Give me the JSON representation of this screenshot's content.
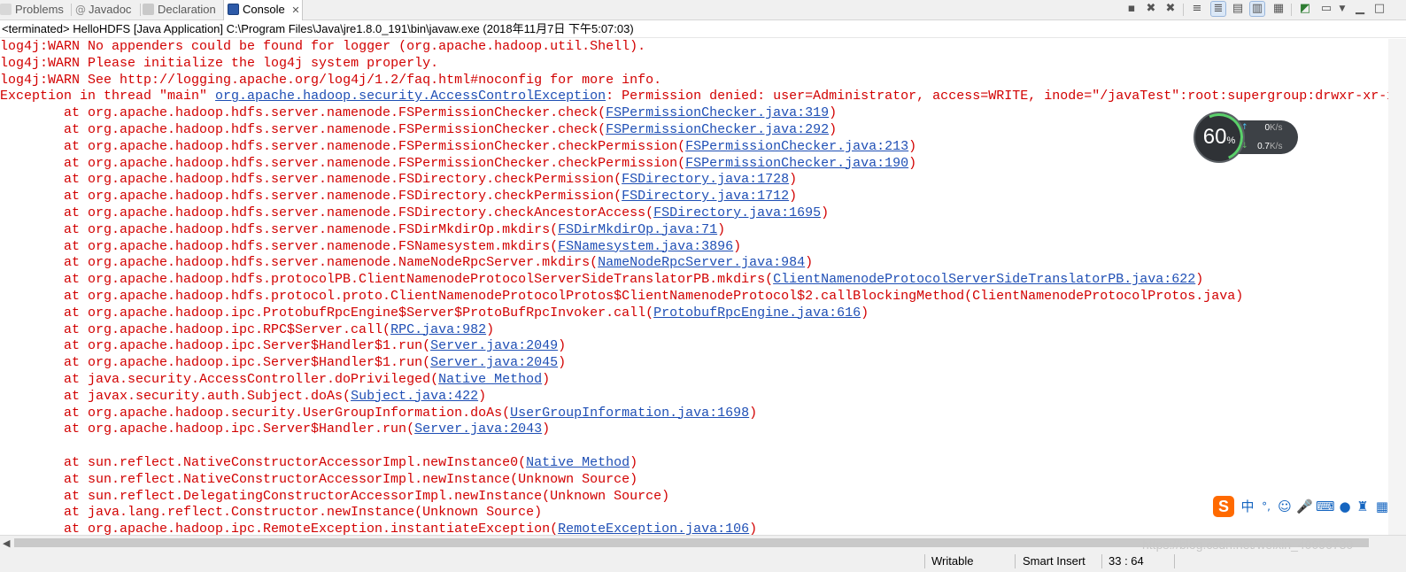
{
  "tabs": [
    {
      "label": "Problems",
      "icon": "problems-icon"
    },
    {
      "label": "Javadoc",
      "icon": "javadoc-icon"
    },
    {
      "label": "Declaration",
      "icon": "declaration-icon"
    },
    {
      "label": "Console",
      "icon": "console-icon",
      "active": true,
      "close": "✕"
    }
  ],
  "toolbar_icons": [
    "clear-console-icon",
    "terminate-icon",
    "remove-all-terminated-icon",
    "scroll-lock-icon",
    "word-wrap-icon",
    "show-on-stdout-icon",
    "show-on-stderr-icon",
    "pin-console-icon",
    "display-console-icon",
    "dropdown-icon",
    "open-console-icon",
    "minimize-icon",
    "maximize-icon"
  ],
  "process_line": "<terminated> HelloHDFS [Java Application] C:\\Program Files\\Java\\jre1.8.0_191\\bin\\javaw.exe (2018年11月7日 下午5:07:03)",
  "console": {
    "warn1": "log4j:WARN No appenders could be found for logger (org.apache.hadoop.util.Shell).",
    "warn2": "log4j:WARN Please initialize the log4j system properly.",
    "warn3": "log4j:WARN See http://logging.apache.org/log4j/1.2/faq.html#noconfig for more info.",
    "exception_prefix": "Exception in thread \"main\" ",
    "exception_class": "org.apache.hadoop.security.AccessControlException",
    "exception_message": ": Permission denied: user=Administrator, access=WRITE, inode=\"/javaTest\":root:supergroup:drwxr-xr-x",
    "frames": [
      {
        "at": "at org.apache.hadoop.hdfs.server.namenode.FSPermissionChecker.check(",
        "link": "FSPermissionChecker.java:319",
        "end": ")"
      },
      {
        "at": "at org.apache.hadoop.hdfs.server.namenode.FSPermissionChecker.check(",
        "link": "FSPermissionChecker.java:292",
        "end": ")"
      },
      {
        "at": "at org.apache.hadoop.hdfs.server.namenode.FSPermissionChecker.checkPermission(",
        "link": "FSPermissionChecker.java:213",
        "end": ")"
      },
      {
        "at": "at org.apache.hadoop.hdfs.server.namenode.FSPermissionChecker.checkPermission(",
        "link": "FSPermissionChecker.java:190",
        "end": ")"
      },
      {
        "at": "at org.apache.hadoop.hdfs.server.namenode.FSDirectory.checkPermission(",
        "link": "FSDirectory.java:1728",
        "end": ")"
      },
      {
        "at": "at org.apache.hadoop.hdfs.server.namenode.FSDirectory.checkPermission(",
        "link": "FSDirectory.java:1712",
        "end": ")"
      },
      {
        "at": "at org.apache.hadoop.hdfs.server.namenode.FSDirectory.checkAncestorAccess(",
        "link": "FSDirectory.java:1695",
        "end": ")"
      },
      {
        "at": "at org.apache.hadoop.hdfs.server.namenode.FSDirMkdirOp.mkdirs(",
        "link": "FSDirMkdirOp.java:71",
        "end": ")"
      },
      {
        "at": "at org.apache.hadoop.hdfs.server.namenode.FSNamesystem.mkdirs(",
        "link": "FSNamesystem.java:3896",
        "end": ")"
      },
      {
        "at": "at org.apache.hadoop.hdfs.server.namenode.NameNodeRpcServer.mkdirs(",
        "link": "NameNodeRpcServer.java:984",
        "end": ")"
      },
      {
        "at": "at org.apache.hadoop.hdfs.protocolPB.ClientNamenodeProtocolServerSideTranslatorPB.mkdirs(",
        "link": "ClientNamenodeProtocolServerSideTranslatorPB.java:622",
        "end": ")"
      },
      {
        "at": "at org.apache.hadoop.hdfs.protocol.proto.ClientNamenodeProtocolProtos$ClientNamenodeProtocol$2.callBlockingMethod(ClientNamenodeProtocolProtos.java)",
        "link": "",
        "end": ""
      },
      {
        "at": "at org.apache.hadoop.ipc.ProtobufRpcEngine$Server$ProtoBufRpcInvoker.call(",
        "link": "ProtobufRpcEngine.java:616",
        "end": ")"
      },
      {
        "at": "at org.apache.hadoop.ipc.RPC$Server.call(",
        "link": "RPC.java:982",
        "end": ")"
      },
      {
        "at": "at org.apache.hadoop.ipc.Server$Handler$1.run(",
        "link": "Server.java:2049",
        "end": ")"
      },
      {
        "at": "at org.apache.hadoop.ipc.Server$Handler$1.run(",
        "link": "Server.java:2045",
        "end": ")"
      },
      {
        "at": "at java.security.AccessController.doPrivileged(",
        "link": "Native Method",
        "end": ")"
      },
      {
        "at": "at javax.security.auth.Subject.doAs(",
        "link": "Subject.java:422",
        "end": ")"
      },
      {
        "at": "at org.apache.hadoop.security.UserGroupInformation.doAs(",
        "link": "UserGroupInformation.java:1698",
        "end": ")"
      },
      {
        "at": "at org.apache.hadoop.ipc.Server$Handler.run(",
        "link": "Server.java:2043",
        "end": ")"
      },
      {
        "at": "",
        "link": "",
        "end": ""
      },
      {
        "at": "at sun.reflect.NativeConstructorAccessorImpl.newInstance0(",
        "link": "Native Method",
        "end": ")"
      },
      {
        "at": "at sun.reflect.NativeConstructorAccessorImpl.newInstance(Unknown Source)",
        "link": "",
        "end": ""
      },
      {
        "at": "at sun.reflect.DelegatingConstructorAccessorImpl.newInstance(Unknown Source)",
        "link": "",
        "end": ""
      },
      {
        "at": "at java.lang.reflect.Constructor.newInstance(Unknown Source)",
        "link": "",
        "end": ""
      },
      {
        "at": "at org.apache.hadoop.ipc.RemoteException.instantiateException(",
        "link": "RemoteException.java:106",
        "end": ")"
      }
    ]
  },
  "net_widget": {
    "percent": "60",
    "percent_unit": "%",
    "up_rate": "0",
    "down_rate": "0.7",
    "rate_unit": "K/s",
    "ring_color": "#5ad06a"
  },
  "ime_bar": {
    "logo": "S",
    "mode": "中",
    "punct": "°,"
  },
  "status_bar": {
    "writable": "Writable",
    "insert_mode": "Smart Insert",
    "position": "33 : 64"
  },
  "watermark": "https://blog.csdn.net/weixin_40096730"
}
